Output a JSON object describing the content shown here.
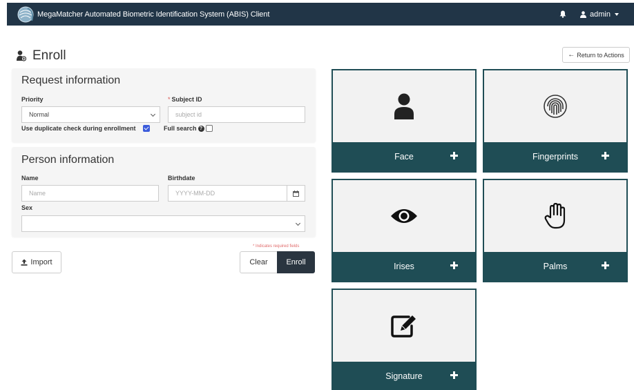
{
  "navbar": {
    "title": "MegaMatcher Automated Biometric Identification System (ABIS) Client",
    "user": "admin",
    "icons": {
      "logo": "globe-fingerprint-logo",
      "notifications": "bell-icon",
      "user": "user-icon"
    }
  },
  "page": {
    "title": "Enroll",
    "title_icon": "user-add-icon",
    "return_button": "Return to Actions"
  },
  "request_info": {
    "heading": "Request information",
    "priority_label": "Priority",
    "priority_value": "Normal",
    "subject_id_label": "Subject ID",
    "subject_id_placeholder": "subject id",
    "duplicate_check_label": "Use duplicate check during enrollment",
    "duplicate_check_checked": true,
    "full_search_label": "Full search",
    "full_search_checked": false
  },
  "person_info": {
    "heading": "Person information",
    "name_label": "Name",
    "name_placeholder": "Name",
    "birthdate_label": "Birthdate",
    "birthdate_placeholder": "YYYY-MM-DD",
    "sex_label": "Sex",
    "sex_value": ""
  },
  "form": {
    "required_note": "* Indicates required fields",
    "import_button": "Import",
    "clear_button": "Clear",
    "enroll_button": "Enroll"
  },
  "modalities": [
    {
      "label": "Face",
      "icon": "person-icon"
    },
    {
      "label": "Fingerprints",
      "icon": "fingerprint-icon"
    },
    {
      "label": "Irises",
      "icon": "eye-icon"
    },
    {
      "label": "Palms",
      "icon": "hand-icon"
    },
    {
      "label": "Signature",
      "icon": "signature-icon"
    }
  ],
  "colors": {
    "navbar": "#213547",
    "card_accent": "#1f4d55",
    "enroll_button": "#2a3540",
    "checkbox": "#3b5bdb",
    "required": "#d9534f"
  }
}
